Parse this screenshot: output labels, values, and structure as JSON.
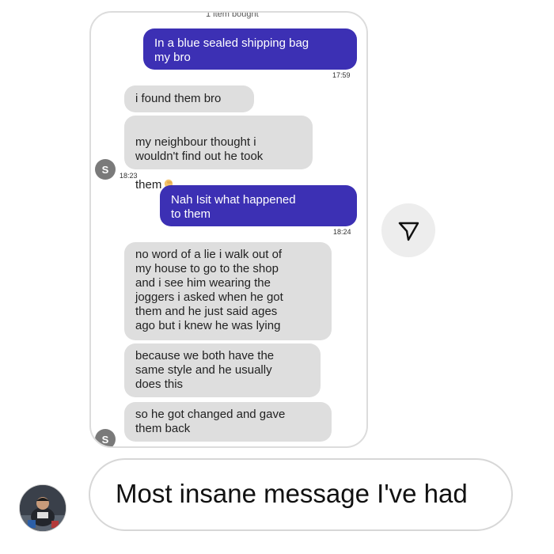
{
  "header": {
    "cut_label": "1 item bought"
  },
  "messages": [
    {
      "id": "m1",
      "direction": "outgoing",
      "text": "In a blue sealed shipping bag\nmy bro",
      "time": "17:59"
    },
    {
      "id": "m2",
      "direction": "incoming",
      "text": "i found them bro"
    },
    {
      "id": "m3",
      "direction": "incoming",
      "text": "my neighbour thought i\nwouldn't find out he took\nthem",
      "emoji": "man-facepalming",
      "time": "18:23",
      "sender_initial": "S"
    },
    {
      "id": "m4",
      "direction": "outgoing",
      "text": "Nah Isit what happened\nto them",
      "time": "18:24"
    },
    {
      "id": "m5",
      "direction": "incoming",
      "text": "no word of a lie i walk out of\nmy house to go to the shop\nand i see him wearing the\njoggers i asked when he got\nthem and he just said ages\nago but i knew he was lying"
    },
    {
      "id": "m6",
      "direction": "incoming",
      "text": "because we both have the\nsame style and he usually\ndoes this"
    },
    {
      "id": "m7",
      "direction": "incoming",
      "text": "so he got changed and gave\nthem back",
      "sender_initial": "S"
    }
  ],
  "send_button": {
    "icon": "paper-plane-icon"
  },
  "reply": {
    "text": "Most insane message I've had",
    "avatar": "user-avatar-photo"
  },
  "colors": {
    "outgoing_bubble": "#3c30b4",
    "incoming_bubble": "#dedede"
  }
}
